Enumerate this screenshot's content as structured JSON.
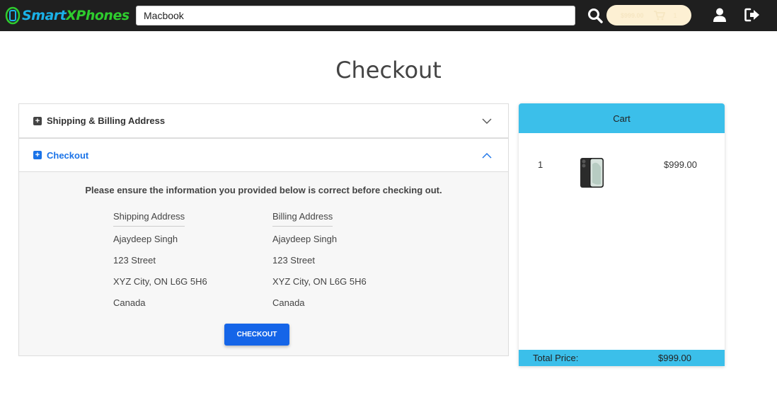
{
  "brand": {
    "smart": "Smart",
    "x": "X",
    "phones": "Phones"
  },
  "search": {
    "value": "Macbook",
    "placeholder": ""
  },
  "cart_pill": {
    "total": "$999.00",
    "count": "1"
  },
  "page": {
    "title": "Checkout"
  },
  "accordion": {
    "shipping_header": "Shipping & Billing Address",
    "checkout_header": "Checkout",
    "notice": "Please ensure the information you provided below is correct before checking out.",
    "shipping": {
      "heading": "Shipping Address",
      "name": "Ajaydeep Singh",
      "street": "123 Street",
      "city": "XYZ City, ON L6G 5H6",
      "country": "Canada"
    },
    "billing": {
      "heading": "Billing Address",
      "name": "Ajaydeep Singh",
      "street": "123 Street",
      "city": "XYZ City, ON L6G 5H6",
      "country": "Canada"
    },
    "checkout_button": "CHECKOUT"
  },
  "cart": {
    "title": "Cart",
    "items": [
      {
        "qty": "1",
        "image": "iphone-product-image",
        "price": "$999.00"
      }
    ],
    "total_label": "Total Price:",
    "total_value": "$999.00"
  },
  "colors": {
    "navbar": "#1f1f1f",
    "accent_blue": "#1a73e8",
    "cart_header": "#3bbfea",
    "cart_pill": "#fdf0d3",
    "logo_blue": "#1ab1e8",
    "logo_green": "#2ecc2e"
  },
  "icons": {
    "search": "search-icon",
    "cart": "cart-icon",
    "user": "user-icon",
    "logout": "logout-icon",
    "expand": "chevron-down-icon",
    "collapse": "chevron-up-icon"
  }
}
